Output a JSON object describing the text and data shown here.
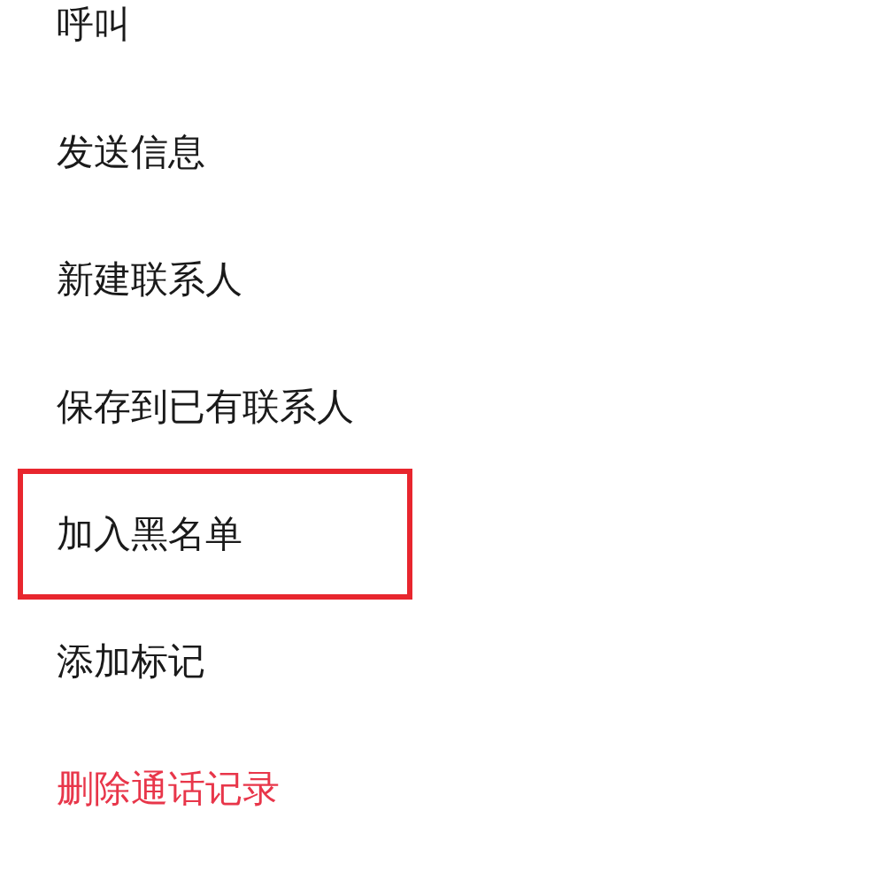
{
  "menu": {
    "items": [
      {
        "label": "呼叫",
        "kind": "normal",
        "highlighted": false
      },
      {
        "label": "发送信息",
        "kind": "normal",
        "highlighted": false
      },
      {
        "label": "新建联系人",
        "kind": "normal",
        "highlighted": false
      },
      {
        "label": "保存到已有联系人",
        "kind": "normal",
        "highlighted": false
      },
      {
        "label": "加入黑名单",
        "kind": "normal",
        "highlighted": true
      },
      {
        "label": "添加标记",
        "kind": "normal",
        "highlighted": false
      },
      {
        "label": "删除通话记录",
        "kind": "danger",
        "highlighted": false
      }
    ]
  }
}
